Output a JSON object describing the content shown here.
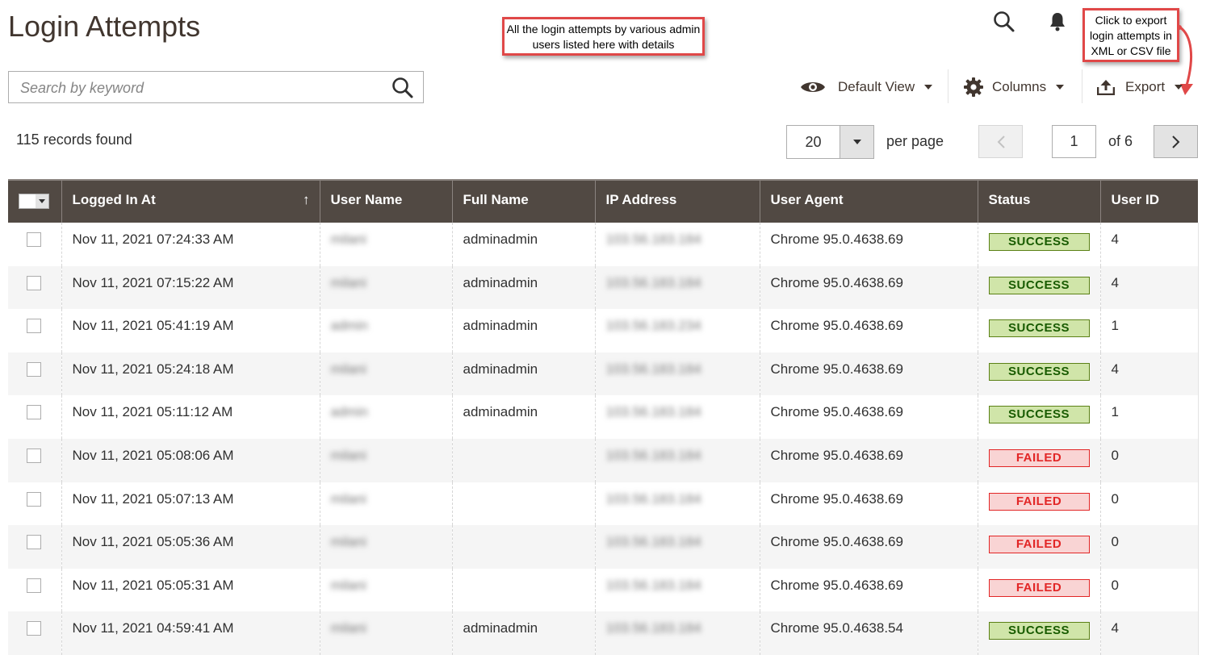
{
  "header": {
    "title": "Login Attempts"
  },
  "annotations": {
    "grid_note": "All the login attempts by various admin users listed here with details",
    "export_note": "Click to export login attempts in XML or CSV file"
  },
  "search": {
    "placeholder": "Search by keyword",
    "value": ""
  },
  "toolbar": {
    "view_label": "Default View",
    "columns_label": "Columns",
    "export_label": "Export"
  },
  "records_found": "115 records found",
  "pagination": {
    "per_page_value": "20",
    "per_page_label": "per page",
    "current_page": "1",
    "of_pages": "of 6"
  },
  "grid": {
    "columns": [
      "Logged In At",
      "User Name",
      "Full Name",
      "IP Address",
      "User Agent",
      "Status",
      "User ID"
    ],
    "sort_indicator": "↑",
    "rows": [
      {
        "logged_in_at": "Nov 11, 2021 07:24:33 AM",
        "user_name": "milani",
        "full_name": "adminadmin",
        "ip": "103.56.183.184",
        "agent": "Chrome 95.0.4638.69",
        "status": "SUCCESS",
        "user_id": "4"
      },
      {
        "logged_in_at": "Nov 11, 2021 07:15:22 AM",
        "user_name": "milani",
        "full_name": "adminadmin",
        "ip": "103.56.183.184",
        "agent": "Chrome 95.0.4638.69",
        "status": "SUCCESS",
        "user_id": "4"
      },
      {
        "logged_in_at": "Nov 11, 2021 05:41:19 AM",
        "user_name": "admin",
        "full_name": "adminadmin",
        "ip": "103.56.183.234",
        "agent": "Chrome 95.0.4638.69",
        "status": "SUCCESS",
        "user_id": "1"
      },
      {
        "logged_in_at": "Nov 11, 2021 05:24:18 AM",
        "user_name": "milani",
        "full_name": "adminadmin",
        "ip": "103.56.183.184",
        "agent": "Chrome 95.0.4638.69",
        "status": "SUCCESS",
        "user_id": "4"
      },
      {
        "logged_in_at": "Nov 11, 2021 05:11:12 AM",
        "user_name": "admin",
        "full_name": "adminadmin",
        "ip": "103.56.183.184",
        "agent": "Chrome 95.0.4638.69",
        "status": "SUCCESS",
        "user_id": "1"
      },
      {
        "logged_in_at": "Nov 11, 2021 05:08:06 AM",
        "user_name": "milani",
        "full_name": "",
        "ip": "103.56.183.184",
        "agent": "Chrome 95.0.4638.69",
        "status": "FAILED",
        "user_id": "0"
      },
      {
        "logged_in_at": "Nov 11, 2021 05:07:13 AM",
        "user_name": "milani",
        "full_name": "",
        "ip": "103.56.183.184",
        "agent": "Chrome 95.0.4638.69",
        "status": "FAILED",
        "user_id": "0"
      },
      {
        "logged_in_at": "Nov 11, 2021 05:05:36 AM",
        "user_name": "milani",
        "full_name": "",
        "ip": "103.56.183.184",
        "agent": "Chrome 95.0.4638.69",
        "status": "FAILED",
        "user_id": "0"
      },
      {
        "logged_in_at": "Nov 11, 2021 05:05:31 AM",
        "user_name": "milani",
        "full_name": "",
        "ip": "103.56.183.184",
        "agent": "Chrome 95.0.4638.69",
        "status": "FAILED",
        "user_id": "0"
      },
      {
        "logged_in_at": "Nov 11, 2021 04:59:41 AM",
        "user_name": "milani",
        "full_name": "adminadmin",
        "ip": "103.56.183.184",
        "agent": "Chrome 95.0.4638.54",
        "status": "SUCCESS",
        "user_id": "4"
      }
    ]
  },
  "icons": {
    "search": "search-icon",
    "bell": "bell-icon",
    "view": "eye-icon",
    "columns": "gear-icon",
    "export": "upload-icon"
  },
  "colors": {
    "header_bg": "#514943",
    "success_bg": "#d0e5a9",
    "success_text": "#185b00",
    "failed_bg": "#f9d4d4",
    "failed_text": "#e22626",
    "callout_border": "#e04848"
  }
}
